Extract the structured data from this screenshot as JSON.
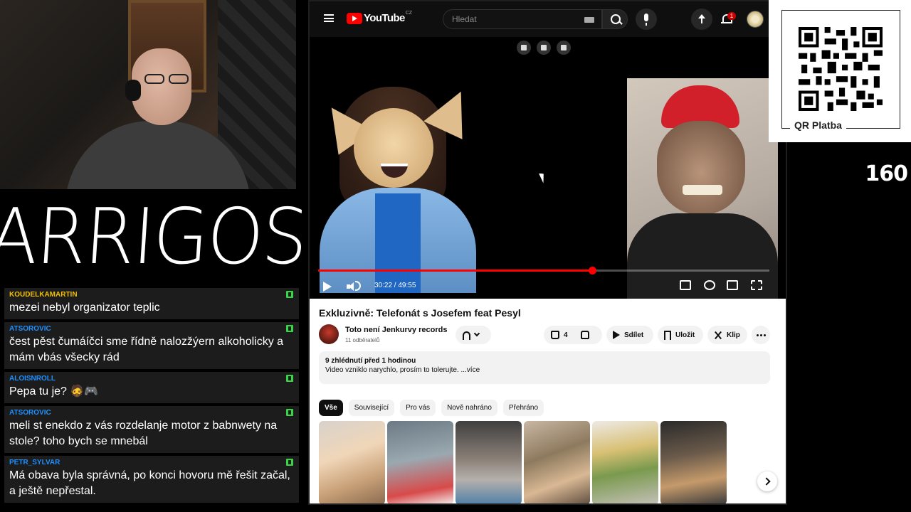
{
  "stream": {
    "logo_text": "ARRIGOS",
    "qr_label": "QR Platba",
    "counter": "160"
  },
  "chat": [
    {
      "user": "KOUDELKAMARTIN",
      "user_color": "#f0c000",
      "text": "mezei nebyl organizator teplic"
    },
    {
      "user": "ATSOROVIC",
      "user_color": "#1e90ff",
      "text": "čest pěst čumáíčci sme řídně nalozžýern alkoholicky a mám vbás všecky rád"
    },
    {
      "user": "ALOISNROLL",
      "user_color": "#1e90ff",
      "text": "Pepa tu je? 🧔🎮"
    },
    {
      "user": "ATSOROVIC",
      "user_color": "#1e90ff",
      "text": "meli st enekdo z vás rozdelanje motor z babnwety na stole? toho bych se mnebál"
    },
    {
      "user": "PETR_SYLVAR",
      "user_color": "#1e90ff",
      "text": "Má obava byla správná, po konci hovoru mě řešit začal, a ještě nepřestal."
    }
  ],
  "youtube": {
    "logo_text": "YouTube",
    "country": "CZ",
    "search_placeholder": "Hledat",
    "notification_count": "1",
    "player": {
      "current_time": "30:22",
      "duration": "49:55",
      "time_display": "30:22 / 49:55",
      "progress": 0.608
    },
    "video": {
      "title": "Exkluzivně: Telefonát s Josefem feat Pesyl",
      "channel_name": "Toto není Jenkurvy records",
      "subscribers": "11 odběratelů",
      "likes": "4",
      "share_label": "Sdílet",
      "save_label": "Uložit",
      "clip_label": "Klip",
      "views_meta": "9 zhlédnutí  před 1 hodinou",
      "description": "Video vzniklo narychlo, prosím to tolerujte. ...více"
    },
    "chips": [
      {
        "label": "Vše",
        "active": true
      },
      {
        "label": "Související",
        "active": false
      },
      {
        "label": "Pro vás",
        "active": false
      },
      {
        "label": "Nově nahráno",
        "active": false
      },
      {
        "label": "Přehráno",
        "active": false
      }
    ]
  },
  "colors": {
    "yt_red": "#ff0000",
    "chat_badge": "#3ad447"
  }
}
